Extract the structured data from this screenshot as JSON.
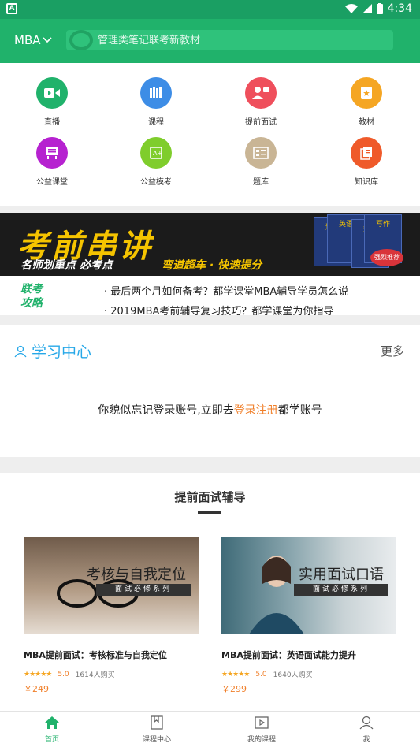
{
  "status_bar": {
    "time": "4:34",
    "app_badge": "A"
  },
  "top_bar": {
    "category": "MBA",
    "search_placeholder": "管理类笔记联考新教材"
  },
  "quick_menu": [
    {
      "label": "直播",
      "icon": "video-icon",
      "color": "#20b26b"
    },
    {
      "label": "课程",
      "icon": "books-icon",
      "color": "#3d8de6"
    },
    {
      "label": "提前面试",
      "icon": "interview-icon",
      "color": "#ef4f5c"
    },
    {
      "label": "教材",
      "icon": "textbook-icon",
      "color": "#f5a623"
    },
    {
      "label": "公益课堂",
      "icon": "classroom-icon",
      "color": "#b622d0"
    },
    {
      "label": "公益模考",
      "icon": "mock-exam-icon",
      "color": "#7fcd2c"
    },
    {
      "label": "题库",
      "icon": "question-bank-icon",
      "color": "#c9b595"
    },
    {
      "label": "知识库",
      "icon": "knowledge-icon",
      "color": "#ef5a2a"
    }
  ],
  "banner": {
    "headline": "考前串讲",
    "sub_left": "名师划重点 必考点",
    "sub_right": "弯道超车 · 快速提分",
    "books": [
      "英语",
      "写作",
      "逻辑",
      "数学"
    ],
    "badge": "强烈推荐"
  },
  "news": {
    "tag_line1": "联考",
    "tag_line2": "攻略",
    "items": [
      "· 最后两个月如何备考？都学课堂MBA辅导学员怎么说",
      "· 2019MBA考前辅导复习技巧？都学课堂为你指导"
    ]
  },
  "study_center": {
    "title": "学习中心",
    "more": "更多",
    "login_prefix": "你貌似忘记登录账号,立即去",
    "login_link": "登录注册",
    "login_suffix": "都学账号"
  },
  "interview_section": {
    "heading": "提前面试辅导",
    "courses": [
      {
        "thumb_caption": "考核与自我定位",
        "thumb_ribbon": "面试必修系列",
        "name": "MBA提前面试：考核标准与自我定位",
        "rating": "5.0",
        "buyers": "1614人购买",
        "price": "￥249"
      },
      {
        "thumb_caption": "实用面试口语",
        "thumb_ribbon": "面试必修系列",
        "name": "MBA提前面试：英语面试能力提升",
        "rating": "5.0",
        "buyers": "1640人购买",
        "price": "￥299"
      }
    ]
  },
  "tab_bar": [
    {
      "label": "首页",
      "icon": "home-icon",
      "active": true
    },
    {
      "label": "课程中心",
      "icon": "bookmark-icon",
      "active": false
    },
    {
      "label": "我的课程",
      "icon": "play-icon",
      "active": false
    },
    {
      "label": "我",
      "icon": "user-icon",
      "active": false
    }
  ],
  "colors": {
    "brand_green": "#20b26b",
    "accent_orange": "#f07f2a",
    "link_blue": "#27a8e8"
  }
}
